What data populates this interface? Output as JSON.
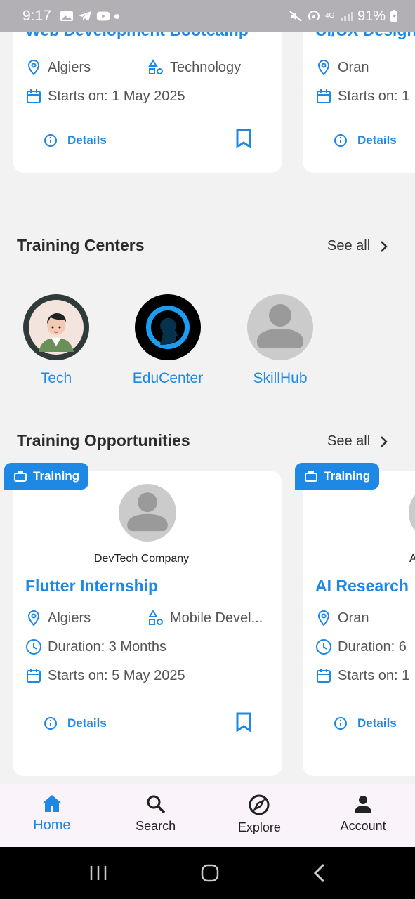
{
  "status": {
    "time": "9:17",
    "battery": "91%",
    "network": "4G"
  },
  "top_cards": [
    {
      "title": "Web Development Bootcamp",
      "location": "Algiers",
      "category": "Technology",
      "starts": "Starts on: 1 May 2025",
      "details_label": "Details"
    },
    {
      "title": "UI/UX Design",
      "location": "Oran",
      "starts": "Starts on: 1",
      "details_label": "Details"
    }
  ],
  "centers_section": {
    "title": "Training Centers",
    "see_all": "See all",
    "items": [
      {
        "name": "Tech"
      },
      {
        "name": "EduCenter"
      },
      {
        "name": "SkillHub"
      }
    ]
  },
  "opportunities_section": {
    "title": "Training Opportunities",
    "see_all": "See all",
    "items": [
      {
        "badge": "Training",
        "company": "DevTech Company",
        "title": "Flutter Internship",
        "location": "Algiers",
        "category": "Mobile Devel...",
        "duration": "Duration: 3 Months",
        "starts": "Starts on: 5 May 2025",
        "details_label": "Details"
      },
      {
        "badge": "Training",
        "company": "A",
        "title": "AI Research",
        "location": "Oran",
        "duration": "Duration: 6",
        "starts": "Starts on: 1",
        "details_label": "Details"
      }
    ]
  },
  "bottom_nav": {
    "items": [
      {
        "label": "Home",
        "icon": "home-icon",
        "active": true
      },
      {
        "label": "Search",
        "icon": "search-icon"
      },
      {
        "label": "Explore",
        "icon": "compass-icon"
      },
      {
        "label": "Account",
        "icon": "person-icon"
      }
    ]
  },
  "colors": {
    "accent": "#1e88e5",
    "background": "#f2f2f2",
    "status_bar": "#b3b0b5",
    "nav_bg": "#fbf3fa"
  }
}
